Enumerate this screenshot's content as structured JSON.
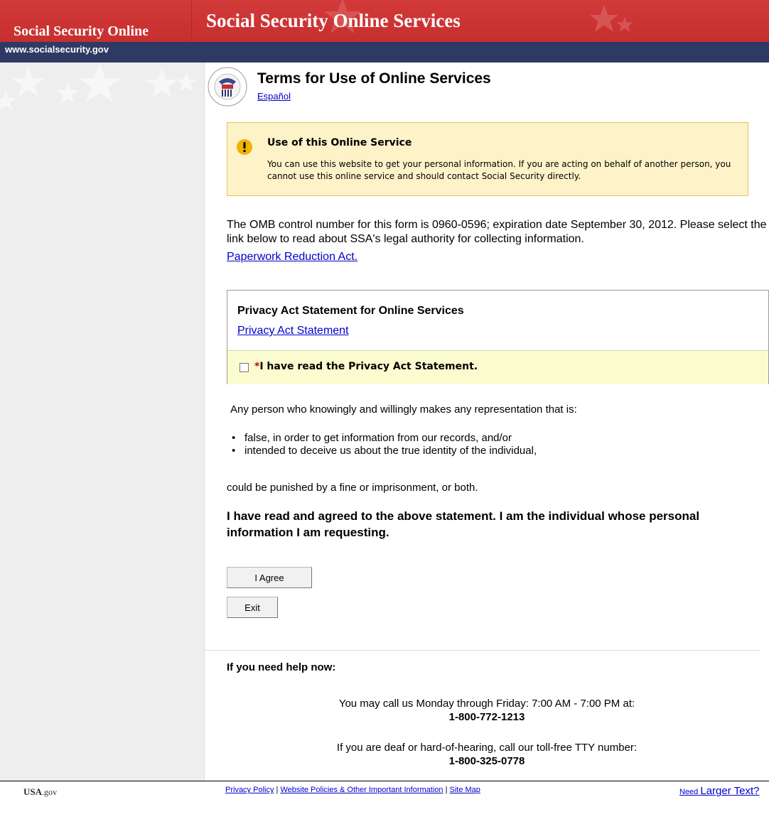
{
  "header": {
    "site_name": "Social Security Online",
    "site_title": "Social Security Online Services",
    "site_url": "www.socialsecurity.gov"
  },
  "main": {
    "page_title": "Terms for Use of Online Services",
    "language_link": "Español",
    "alert": {
      "title": "Use of this Online Service",
      "body": "You can use this website to get your personal information.  If you are acting on behalf of another person, you cannot use this online service and should contact Social Security directly."
    },
    "omb_text": "The OMB control number for this form is 0960-0596;  expiration date September 30, 2012. Please select the link below to read about SSA's legal authority for collecting information.",
    "paperwork_link": "Paperwork Reduction Act.",
    "privacy": {
      "heading": "Privacy Act Statement for Online Services",
      "link": "Privacy Act Statement",
      "required_marker": "*",
      "checkbox_label": "I have read the Privacy Act Statement."
    },
    "warning": {
      "intro": "Any person who knowingly and willingly makes any representation that is:",
      "items": [
        "false, in order to get information from our records, and/or",
        "intended to deceive us about the true identity of the individual,"
      ],
      "outro": "could be punished by a fine or imprisonment, or both."
    },
    "agree_statement": "I have read and agreed to the above statement. I am the individual whose personal information I am requesting.",
    "buttons": {
      "agree": "I Agree",
      "exit": "Exit"
    },
    "help": {
      "heading": "If you need help now:",
      "call_text": "You may call us Monday through Friday: 7:00 AM - 7:00 PM at:",
      "call_number": "1-800-772-1213",
      "tty_text": "If you are deaf or hard-of-hearing, call our toll-free TTY number:",
      "tty_number": "1-800-325-0778"
    }
  },
  "footer": {
    "usa_logo_main": "USA",
    "usa_logo_suffix": ".gov",
    "links": [
      "Privacy Policy",
      "Website Policies & Other Important Information",
      "Site Map"
    ],
    "separator": "|",
    "larger_text_small": "Need ",
    "larger_text_big": "Larger Text?"
  },
  "colors": {
    "header_red": "#c72f2f",
    "header_blue": "#2e3a64",
    "alert_bg": "#fdf2c8",
    "alert_border": "#e7c15c",
    "alert_icon": "#f2b300",
    "check_row_bg": "#fbfbd0",
    "link": "#0000cc"
  },
  "icons": {
    "alert": "exclamation-icon",
    "seal": "ssa-seal-icon",
    "decor": "star-icon"
  }
}
